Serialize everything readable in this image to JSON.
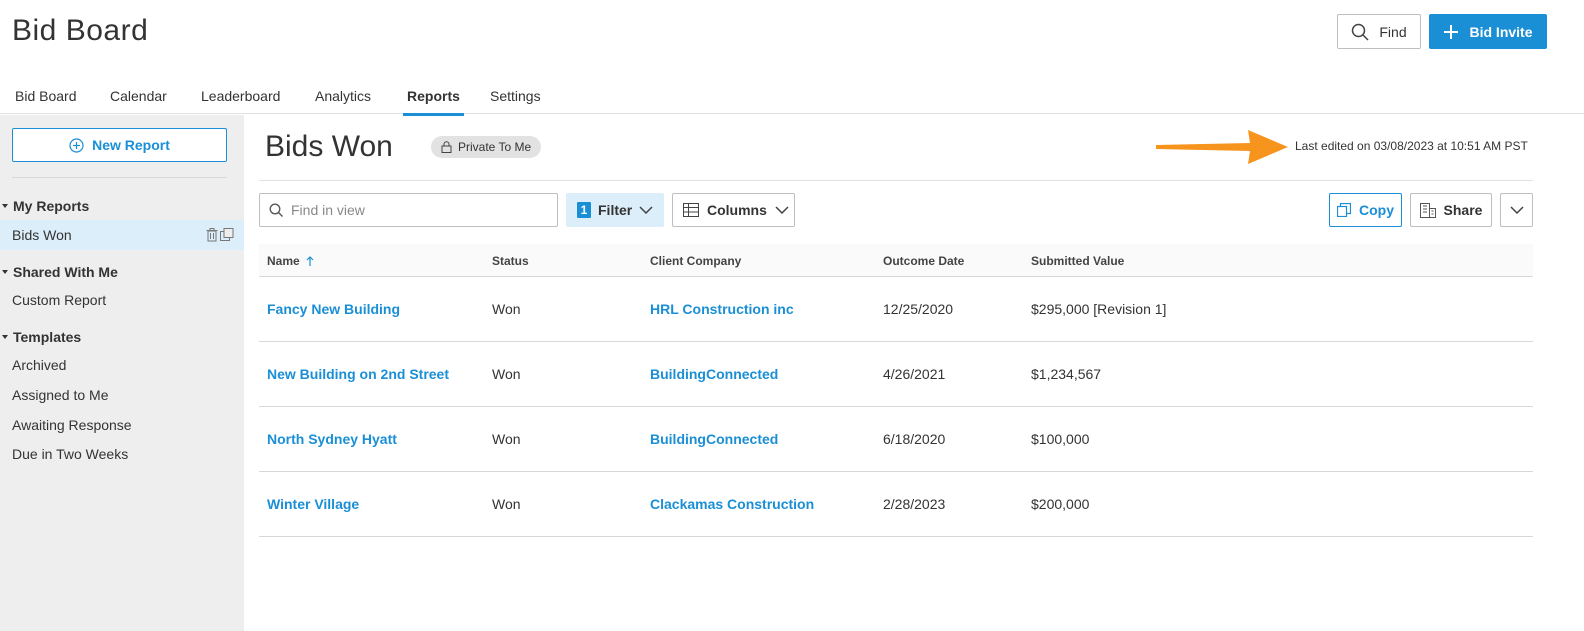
{
  "app": {
    "title": "Bid Board"
  },
  "header": {
    "find_label": "Find",
    "bid_invite_label": "Bid Invite"
  },
  "nav": {
    "tabs": [
      {
        "label": "Bid Board"
      },
      {
        "label": "Calendar"
      },
      {
        "label": "Leaderboard"
      },
      {
        "label": "Analytics"
      },
      {
        "label": "Reports",
        "active": true
      },
      {
        "label": "Settings"
      }
    ]
  },
  "sidebar": {
    "new_report_label": "New Report",
    "sections": [
      {
        "title": "My Reports",
        "items": [
          "Bids Won"
        ]
      },
      {
        "title": "Shared With Me",
        "items": [
          "Custom Report"
        ]
      },
      {
        "title": "Templates",
        "items": [
          "Archived",
          "Assigned to Me",
          "Awaiting Response",
          "Due in Two Weeks"
        ]
      }
    ],
    "active_item": "Bids Won"
  },
  "report": {
    "title": "Bids Won",
    "privacy_badge": "Private To Me",
    "last_edited": "Last edited on 03/08/2023 at 10:51 AM PST"
  },
  "toolbar": {
    "search_placeholder": "Find in view",
    "filter_count": "1",
    "filter_label": "Filter",
    "columns_label": "Columns",
    "copy_label": "Copy",
    "share_label": "Share"
  },
  "table": {
    "columns": [
      "Name",
      "Status",
      "Client Company",
      "Outcome Date",
      "Submitted Value"
    ],
    "rows": [
      {
        "name": "Fancy New Building",
        "status": "Won",
        "client": "HRL Construction inc",
        "date": "12/25/2020",
        "value": "$295,000 [Revision 1]"
      },
      {
        "name": "New Building on 2nd Street",
        "status": "Won",
        "client": "BuildingConnected",
        "date": "4/26/2021",
        "value": "$1,234,567"
      },
      {
        "name": "North Sydney Hyatt",
        "status": "Won",
        "client": "BuildingConnected",
        "date": "6/18/2020",
        "value": "$100,000"
      },
      {
        "name": "Winter Village",
        "status": "Won",
        "client": "Clackamas Construction",
        "date": "2/28/2023",
        "value": "$200,000"
      }
    ]
  },
  "colors": {
    "accent": "#1a8fd6",
    "annotation_arrow": "#f7941d",
    "selected_bg": "#dbeef9"
  },
  "icons": [
    "search-icon",
    "plus-icon",
    "plus-circle-icon",
    "lock-icon",
    "trash-icon",
    "duplicate-icon",
    "grid-icon",
    "copy-icon",
    "share-building-icon",
    "chevron-down-icon",
    "sort-ascending-icon",
    "caret-down-icon"
  ]
}
